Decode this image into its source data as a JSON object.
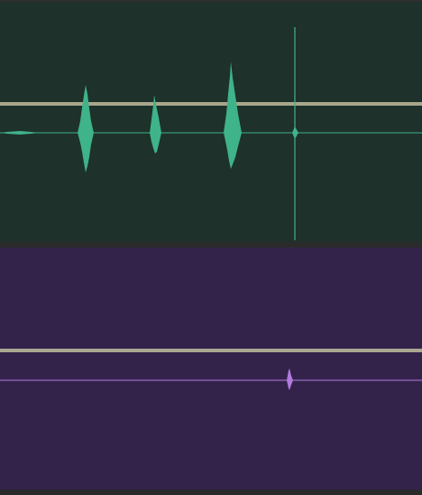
{
  "colors": {
    "background": "#282828",
    "track_1_background": "#1e312a",
    "track_1_waveform": "#3fb38a",
    "track_2_background": "#33234a",
    "track_2_waveform": "#b27adf",
    "gain_line": "#a9a98c"
  },
  "tracks": [
    {
      "id": "track-1",
      "waveform_icon": "waveform-icon"
    },
    {
      "id": "track-2",
      "waveform_icon": "waveform-icon"
    }
  ]
}
